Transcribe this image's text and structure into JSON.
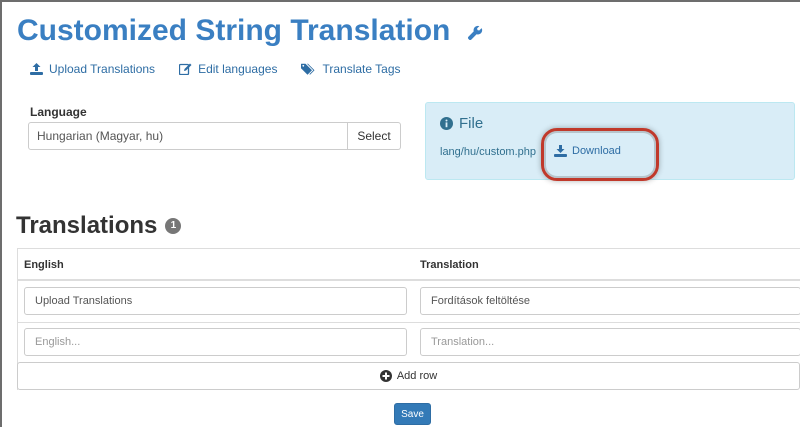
{
  "page": {
    "title": "Customized String Translation"
  },
  "toolbar": {
    "upload_label": "Upload Translations",
    "edit_label": "Edit languages",
    "tags_label": "Translate Tags"
  },
  "language": {
    "label": "Language",
    "value": "Hungarian (Magyar, hu)",
    "select_label": "Select"
  },
  "file": {
    "title": "File",
    "path": "lang/hu/custom.php",
    "download_label": "Download"
  },
  "translations": {
    "heading": "Translations",
    "count": "1",
    "columns": [
      "English",
      "Translation"
    ],
    "rows": [
      {
        "english": "Upload Translations",
        "translation": "Fordítások feltöltése"
      }
    ],
    "new_row": {
      "english_placeholder": "English...",
      "translation_placeholder": "Translation..."
    },
    "add_row_label": "Add row"
  },
  "actions": {
    "save_label": "Save"
  },
  "colors": {
    "link": "#2e6da4",
    "title": "#3a7fc2",
    "info_bg": "#d9edf7",
    "primary": "#337ab7",
    "highlight_ring": "#c0392b"
  }
}
